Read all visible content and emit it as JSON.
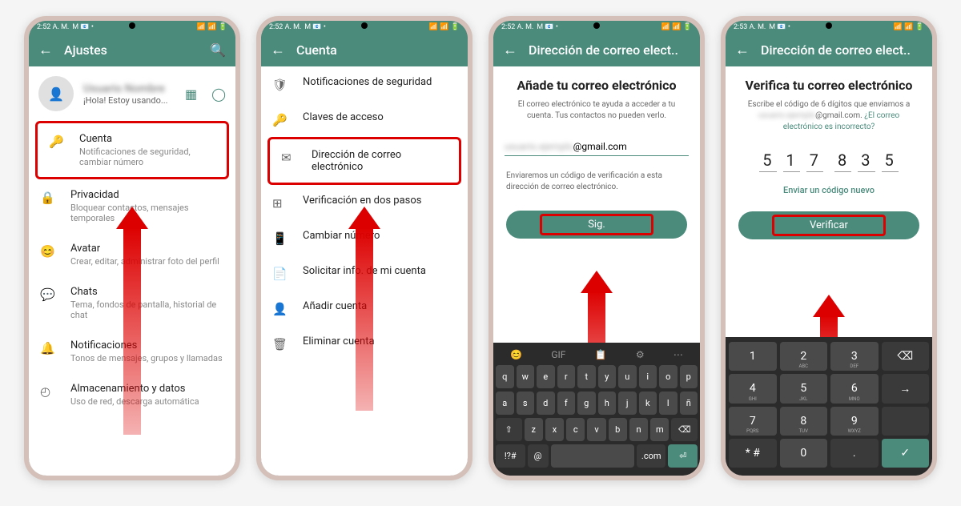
{
  "status": {
    "time1": "2:52 A. M.",
    "time2": "2:53 A. M.",
    "icons_right": "📶 📶 🔋"
  },
  "screen1": {
    "header": "Ajustes",
    "profile_name": "Usuario Nombre",
    "profile_status": "¡Hola! Estoy usando...",
    "items": [
      {
        "icon": "🔑",
        "title": "Cuenta",
        "subtitle": "Notificaciones de seguridad, cambiar número",
        "highlight": true
      },
      {
        "icon": "🔒",
        "title": "Privacidad",
        "subtitle": "Bloquear contactos, mensajes temporales"
      },
      {
        "icon": "😊",
        "title": "Avatar",
        "subtitle": "Crear, editar, administrar foto del perfil"
      },
      {
        "icon": "💬",
        "title": "Chats",
        "subtitle": "Tema, fondos de pantalla, historial de chat"
      },
      {
        "icon": "🔔",
        "title": "Notificaciones",
        "subtitle": "Tonos de mensajes, grupos y llamadas"
      },
      {
        "icon": "📊",
        "title": "Almacenamiento y datos",
        "subtitle": "Uso de red, descarga automática"
      }
    ]
  },
  "screen2": {
    "header": "Cuenta",
    "items": [
      {
        "icon": "🛡",
        "title": "Notificaciones de seguridad"
      },
      {
        "icon": "🔑",
        "title": "Claves de acceso"
      },
      {
        "icon": "✉",
        "title": "Dirección de correo electrónico",
        "highlight": true
      },
      {
        "icon": "⊞",
        "title": "Verificación en dos pasos"
      },
      {
        "icon": "📱",
        "title": "Cambiar número"
      },
      {
        "icon": "📄",
        "title": "Solicitar info. de mi cuenta"
      },
      {
        "icon": "👤",
        "title": "Añadir cuenta"
      },
      {
        "icon": "🗑",
        "title": "Eliminar cuenta"
      }
    ]
  },
  "screen3": {
    "header": "Dirección de correo elect..",
    "title": "Añade tu correo electrónico",
    "desc": "El correo electrónico te ayuda a acceder a tu cuenta. Tus contactos no pueden verlo.",
    "email_suffix": "@gmail.com",
    "note": "Enviaremos un código de verificación a esta dirección de correo electrónico.",
    "button": "Sig.",
    "keyboard": {
      "row1": [
        "q",
        "w",
        "e",
        "r",
        "t",
        "y",
        "u",
        "i",
        "o",
        "p"
      ],
      "row2": [
        "a",
        "s",
        "d",
        "f",
        "g",
        "h",
        "j",
        "k",
        "l",
        "ñ"
      ],
      "row3_shift": "⇧",
      "row3": [
        "z",
        "x",
        "c",
        "v",
        "b",
        "n",
        "m"
      ],
      "row3_del": "⌫",
      "row4": [
        "!?#",
        "@",
        ".com",
        "⏎"
      ]
    }
  },
  "screen4": {
    "header": "Dirección de correo elect..",
    "title": "Verifica tu correo electrónico",
    "desc1": "Escribe el código de 6 dígitos que enviamos a",
    "desc_email": "@gmail.com.",
    "desc_link": "¿El correo electrónico es incorrecto?",
    "code": [
      "5",
      "1",
      "7",
      "8",
      "3",
      "5"
    ],
    "resend": "Enviar un código nuevo",
    "button": "Verificar",
    "numpad": {
      "keys": [
        [
          "1",
          "2 ABC",
          "3 DEF",
          "⌫"
        ],
        [
          "4 GHI",
          "5 JKL",
          "6 MNO",
          "->"
        ],
        [
          "7 PQRS",
          "8 TUV",
          "9 WXYZ",
          ""
        ],
        [
          "* #",
          ".",
          "0",
          "✓"
        ]
      ]
    }
  }
}
